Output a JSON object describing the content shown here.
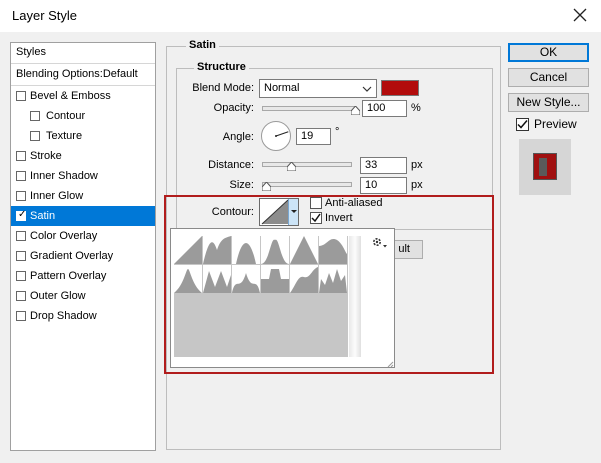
{
  "window": {
    "title": "Layer Style"
  },
  "styles_panel": {
    "header": "Styles",
    "blending": "Blending Options:Default",
    "items": [
      {
        "label": "Bevel & Emboss",
        "checked": false,
        "sub": false
      },
      {
        "label": "Contour",
        "checked": false,
        "sub": true
      },
      {
        "label": "Texture",
        "checked": false,
        "sub": true
      },
      {
        "label": "Stroke",
        "checked": false,
        "sub": false
      },
      {
        "label": "Inner Shadow",
        "checked": false,
        "sub": false
      },
      {
        "label": "Inner Glow",
        "checked": false,
        "sub": false
      },
      {
        "label": "Satin",
        "checked": true,
        "sub": false,
        "selected": true
      },
      {
        "label": "Color Overlay",
        "checked": false,
        "sub": false
      },
      {
        "label": "Gradient Overlay",
        "checked": false,
        "sub": false
      },
      {
        "label": "Pattern Overlay",
        "checked": false,
        "sub": false
      },
      {
        "label": "Outer Glow",
        "checked": false,
        "sub": false
      },
      {
        "label": "Drop Shadow",
        "checked": false,
        "sub": false
      }
    ]
  },
  "satin": {
    "group_label": "Satin",
    "structure_label": "Structure",
    "blend_mode_label": "Blend Mode:",
    "blend_mode_value": "Normal",
    "color": "#b20c0c",
    "opacity_label": "Opacity:",
    "opacity_value": "100",
    "opacity_unit": "%",
    "opacity_level": 1.0,
    "angle_label": "Angle:",
    "angle_value": "19",
    "angle_unit": "°",
    "distance_label": "Distance:",
    "distance_value": "33",
    "distance_unit": "px",
    "distance_level": 0.33,
    "size_label": "Size:",
    "size_value": "10",
    "size_unit": "px",
    "size_level": 0.05,
    "contour_label": "Contour:",
    "anti_aliased_label": "Anti-aliased",
    "anti_aliased_checked": false,
    "invert_label": "Invert",
    "invert_checked": true,
    "partial_button_text": "ult"
  },
  "buttons": {
    "ok": "OK",
    "cancel": "Cancel",
    "new_style": "New Style...",
    "preview_label": "Preview",
    "preview_checked": true
  },
  "icons": {
    "close": "close-icon",
    "gear": "gear-icon",
    "dropdown": "chevron-down-icon"
  },
  "colors": {
    "selection": "#0078d7",
    "highlight": "#b11c1c",
    "swatch": "#b20c0c"
  }
}
